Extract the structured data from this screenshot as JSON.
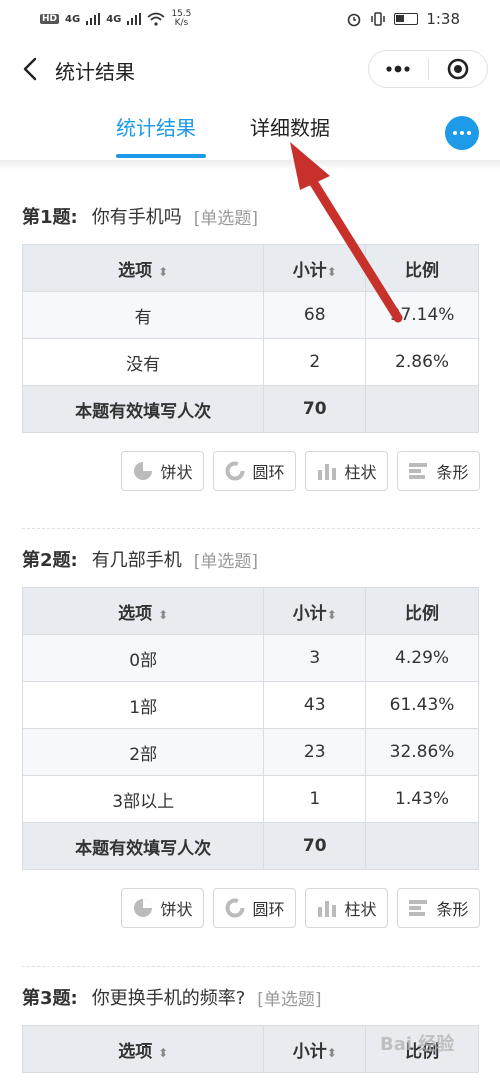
{
  "status_bar": {
    "network": "HD",
    "signal1": "4G",
    "signal2": "4G",
    "speed_value": "15.5",
    "speed_unit": "K/s",
    "time": "1:38"
  },
  "nav": {
    "title": "统计结果"
  },
  "tabs": {
    "active": "统计结果",
    "inactive": "详细数据"
  },
  "table_headers": {
    "option": "选项",
    "sort_glyph": "⬍",
    "count": "小计",
    "ratio": "比例"
  },
  "questions": [
    {
      "number": "第1题:",
      "text": "你有手机吗",
      "type": "[单选题]",
      "rows": [
        {
          "option": "有",
          "count": "68",
          "ratio": "97.14%"
        },
        {
          "option": "没有",
          "count": "2",
          "ratio": "2.86%"
        }
      ],
      "total_label": "本题有效填写人次",
      "total_value": "70"
    },
    {
      "number": "第2题:",
      "text": "有几部手机",
      "type": "[单选题]",
      "rows": [
        {
          "option": "0部",
          "count": "3",
          "ratio": "4.29%"
        },
        {
          "option": "1部",
          "count": "43",
          "ratio": "61.43%"
        },
        {
          "option": "2部",
          "count": "23",
          "ratio": "32.86%"
        },
        {
          "option": "3部以上",
          "count": "1",
          "ratio": "1.43%"
        }
      ],
      "total_label": "本题有效填写人次",
      "total_value": "70"
    },
    {
      "number": "第3题:",
      "text": "你更换手机的频率?",
      "type": "[单选题]"
    }
  ],
  "chart_buttons": {
    "pie": "饼状",
    "ring": "圆环",
    "column": "柱状",
    "bar": "条形"
  },
  "watermark": "Bai 经验",
  "colors": {
    "accent": "#1e9be8",
    "annotation_arrow": "#c8302c",
    "header_bg": "#e8ecf0"
  },
  "icons": [
    "back-icon",
    "menu-dots-icon",
    "close-target-icon",
    "more-dots-icon",
    "pie-chart-icon",
    "ring-chart-icon",
    "column-chart-icon",
    "bar-chart-icon"
  ]
}
